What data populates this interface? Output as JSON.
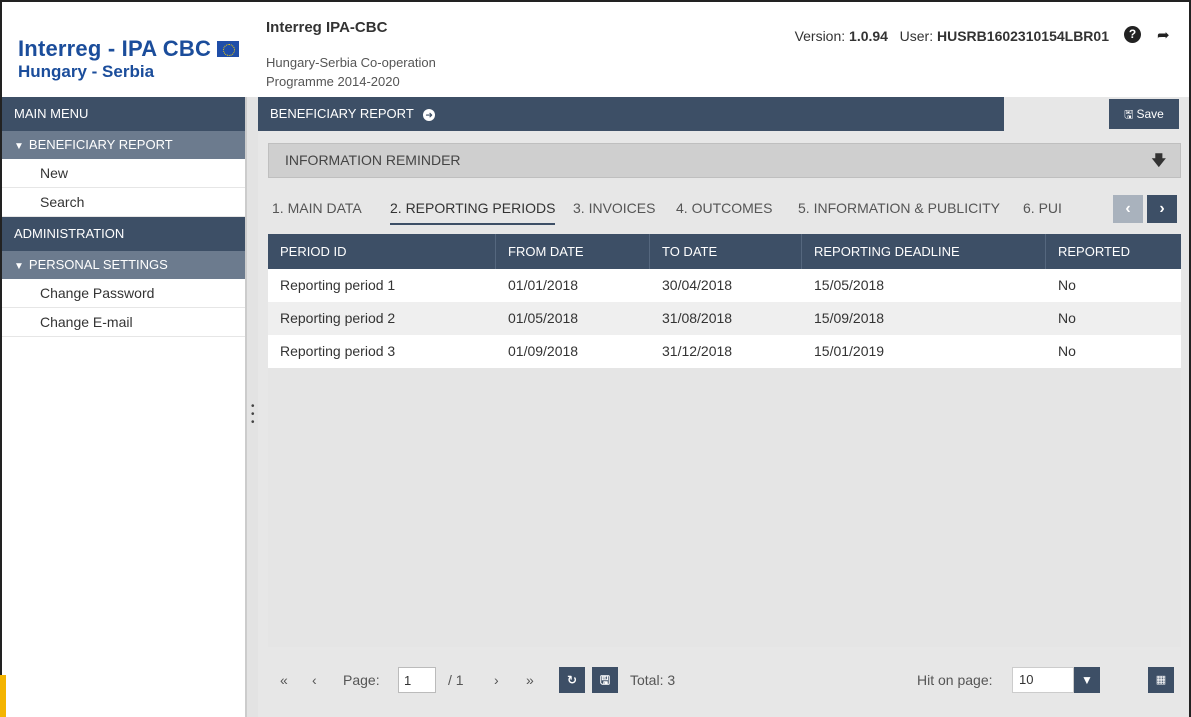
{
  "header": {
    "logo_line1": "Interreg - IPA CBC",
    "logo_line2": "Hungary - Serbia",
    "program_title": "Interreg IPA-CBC",
    "program_subtitle": "Hungary-Serbia Co-operation Programme 2014-2020",
    "version_label": "Version:",
    "version_value": "1.0.94",
    "user_label": "User:",
    "user_value": "HUSRB1602310154LBR01"
  },
  "sidebar": {
    "main_menu": "MAIN MENU",
    "groups": [
      {
        "label": "BENEFICIARY REPORT",
        "items": [
          "New",
          "Search"
        ]
      }
    ],
    "administration": "ADMINISTRATION",
    "personal_settings": {
      "label": "PERSONAL SETTINGS",
      "items": [
        "Change Password",
        "Change E-mail"
      ]
    }
  },
  "main": {
    "section_title": "BENEFICIARY REPORT",
    "save_label": "Save",
    "info_reminder": "INFORMATION REMINDER",
    "tabs": [
      "1. MAIN DATA",
      "2. REPORTING PERIODS",
      "3. INVOICES",
      "4. OUTCOMES",
      "5. INFORMATION & PUBLICITY",
      "6. PUI"
    ],
    "active_tab": 1,
    "table": {
      "columns": [
        "PERIOD ID",
        "FROM DATE",
        "TO DATE",
        "REPORTING DEADLINE",
        "REPORTED"
      ],
      "rows": [
        [
          "Reporting period 1",
          "01/01/2018",
          "30/04/2018",
          "15/05/2018",
          "No"
        ],
        [
          "Reporting period 2",
          "01/05/2018",
          "31/08/2018",
          "15/09/2018",
          "No"
        ],
        [
          "Reporting period 3",
          "01/09/2018",
          "31/12/2018",
          "15/01/2019",
          "No"
        ]
      ]
    },
    "pager": {
      "first": "«",
      "prev": "‹",
      "page_label": "Page:",
      "page_value": "1",
      "of_label": "/ 1",
      "next": "›",
      "last": "»",
      "total_label": "Total: 3",
      "hit_label": "Hit on page:",
      "hit_value": "10"
    }
  },
  "colors": {
    "primary": "#3d4f66",
    "secondary": "#6c7b8e",
    "brand_blue": "#1b4d9b",
    "panel_bg": "#e7e7e7"
  }
}
